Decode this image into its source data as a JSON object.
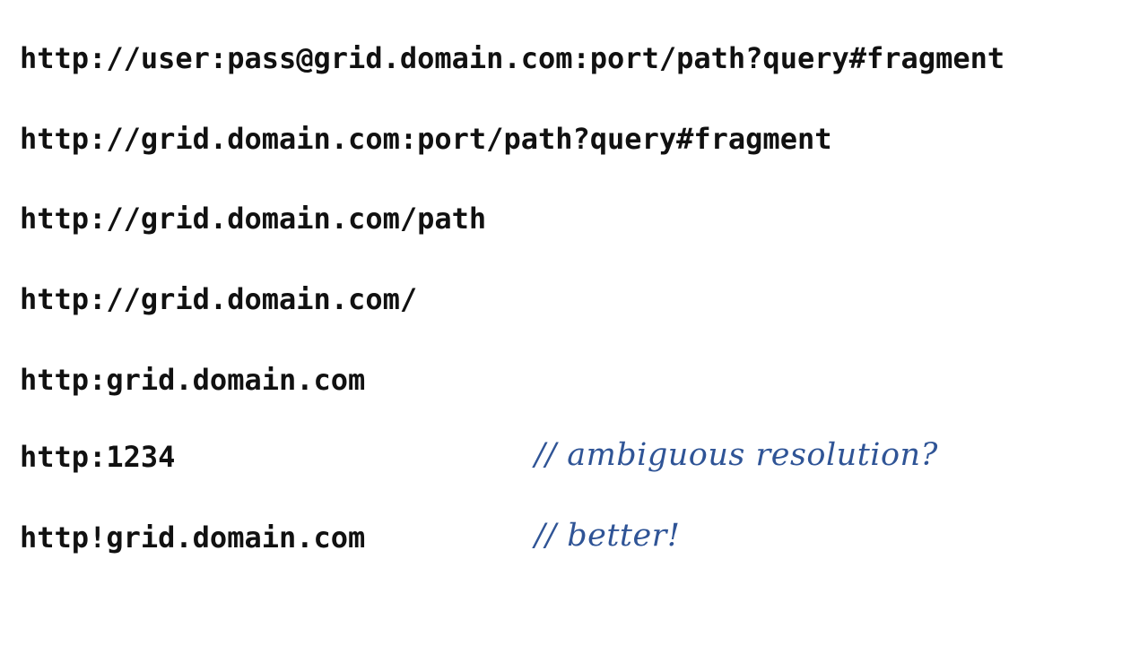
{
  "lines": [
    "http://user:pass@grid.domain.com:port/path?query#fragment",
    "http://grid.domain.com:port/path?query#fragment",
    "http://grid.domain.com/path",
    "http://grid.domain.com/",
    "http:grid.domain.com",
    "http:1234",
    "http!grid.domain.com"
  ],
  "comments": {
    "ambiguous": "// ambiguous resolution?",
    "better": "// better!"
  },
  "colors": {
    "code_text": "#111111",
    "comment_text": "#2f5496",
    "background": "#ffffff"
  }
}
